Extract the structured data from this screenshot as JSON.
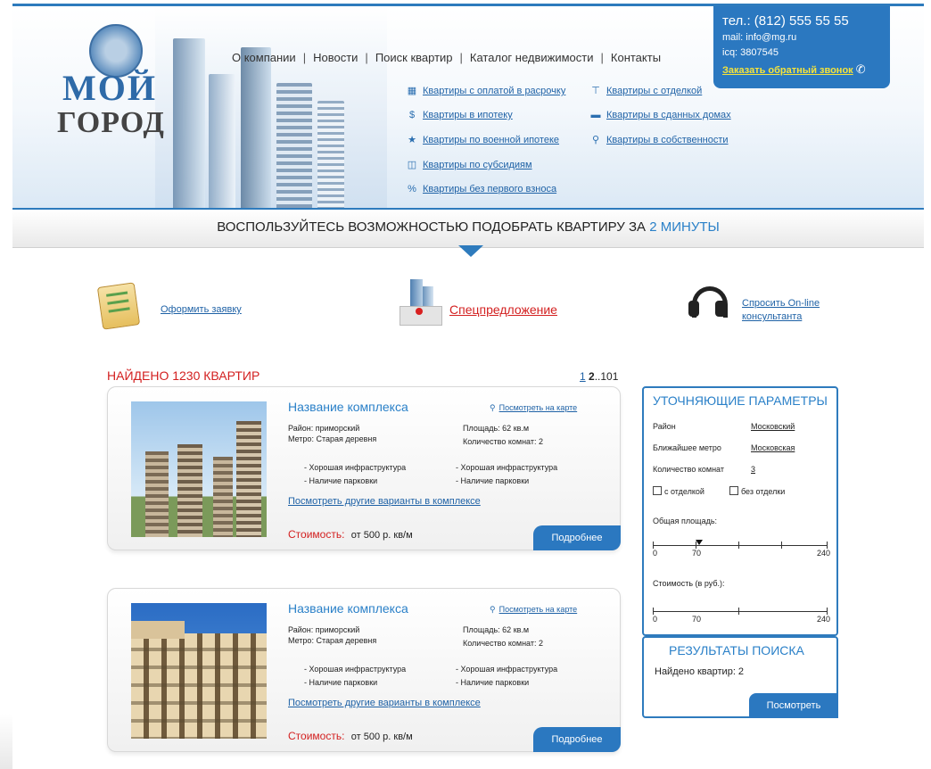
{
  "logo": {
    "line1": "МОЙ",
    "line2": "ГОРОД"
  },
  "main_nav": [
    "О компании",
    "Новости",
    "Поиск квартир",
    "Каталог недвижимости",
    "Контакты"
  ],
  "contact": {
    "tel": "тел.: (812) 555 55 55",
    "mail": "mail: info@mg.ru",
    "icq": "icq:  3807545",
    "callback": "Заказать обратный звонок"
  },
  "sublinks_left": [
    {
      "icon": "calendar-icon",
      "label": "Квартиры с оплатой в расрочку"
    },
    {
      "icon": "dollar-icon",
      "label": "Квартиры в ипотеку"
    },
    {
      "icon": "star-icon",
      "label": "Квартиры по военной ипотеке"
    },
    {
      "icon": "document-icon",
      "label": "Квартиры по субсидиям"
    },
    {
      "icon": "percent-icon",
      "label": "Квартиры без первого взноса"
    }
  ],
  "sublinks_right": [
    {
      "icon": "paint-roller-icon",
      "label": "Квартиры с отделкой"
    },
    {
      "icon": "house-icon",
      "label": "Квартиры в сданных домах"
    },
    {
      "icon": "key-icon",
      "label": "Квартиры в собственности"
    }
  ],
  "banner": {
    "text": "ВОСПОЛЬЗУЙТЕСЬ ВОЗМОЖНОСТЬЮ ПОДОБРАТЬ КВАРТИРУ ЗА",
    "highlight": "2 МИНУТЫ"
  },
  "features": {
    "order": "Оформить заявку",
    "special": "Спецпредложение",
    "ask_line1": "Спросить On-line",
    "ask_line2": "консультанта"
  },
  "found": "НАЙДЕНО 1230 КВАРТИР",
  "pagination": {
    "p1": "1",
    "p2": "2",
    "last": "..101"
  },
  "listings": [
    {
      "title": "Название комплекса",
      "map_link": "Посмотреть на карте",
      "district": "Район: приморский",
      "metro": "Метро: Старая деревня",
      "area": "Площадь: 62 кв.м",
      "rooms": "Количество комнат: 2",
      "f1": "- Хорошая инфраструктура",
      "f2": "- Наличие парковки",
      "f3": "- Хорошая инфраструктура",
      "f4": "- Наличие парковки",
      "more": "Посмотреть другие варианты в комплексе",
      "price_label": "Стоимость:",
      "price_value": "от 500 р. кв/м",
      "details": "Подробнее"
    },
    {
      "title": "Название комплекса",
      "map_link": "Посмотреть на карте",
      "district": "Район: приморский",
      "metro": "Метро: Старая деревня",
      "area": "Площадь: 62 кв.м",
      "rooms": "Количество комнат: 2",
      "f1": "- Хорошая инфраструктура",
      "f2": "- Наличие парковки",
      "f3": "- Хорошая инфраструктура",
      "f4": "- Наличие парковки",
      "more": "Посмотреть другие варианты в комплексе",
      "price_label": "Стоимость:",
      "price_value": "от 500 р. кв/м",
      "details": "Подробнее"
    }
  ],
  "filter": {
    "title": "УТОЧНЯЮЩИЕ ПАРАМЕТРЫ",
    "district_label": "Район",
    "district_value": "Московский",
    "metro_label": "Ближайшее метро",
    "metro_value": "Московская",
    "rooms_label": "Количество комнат",
    "rooms_value": "3",
    "finish": "с отделкой",
    "nofinish": "без отделки",
    "area_label": "Общая площадь:",
    "area_min": "0",
    "area_val": "70",
    "area_max": "240",
    "cost_label": "Стоимость (в руб.):",
    "cost_min": "0",
    "cost_val": "70",
    "cost_max": "240"
  },
  "results": {
    "title": "РЕЗУЛЬТАТЫ ПОИСКА",
    "count": "Найдено квартир: 2",
    "button": "Посмотреть"
  }
}
